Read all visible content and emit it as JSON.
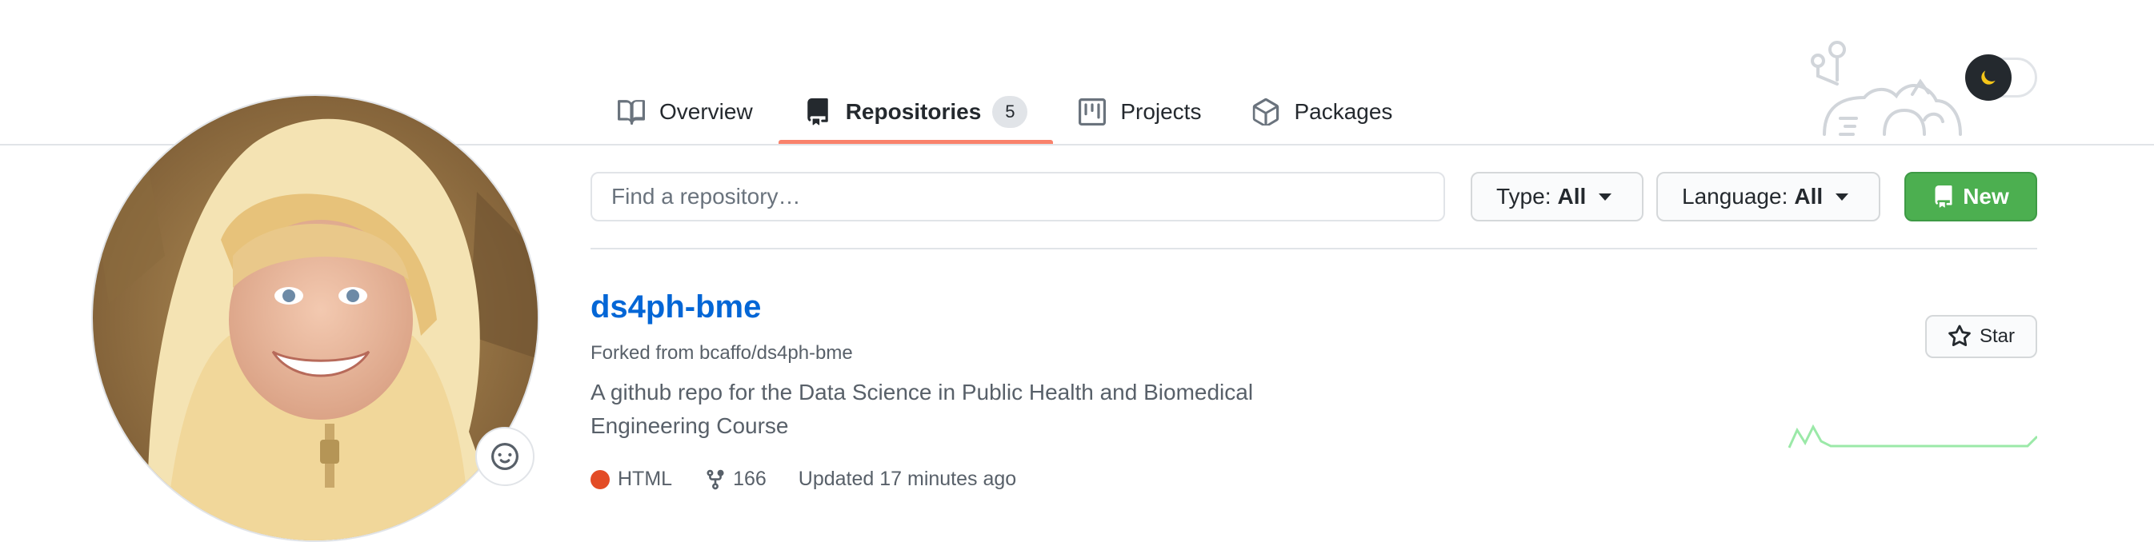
{
  "nav": {
    "tabs": [
      {
        "label": "Overview",
        "icon": "book-icon"
      },
      {
        "label": "Repositories",
        "icon": "repo-icon",
        "count": "5"
      },
      {
        "label": "Projects",
        "icon": "project-icon"
      },
      {
        "label": "Packages",
        "icon": "package-icon"
      }
    ]
  },
  "filter": {
    "search_placeholder": "Find a repository…",
    "type_label": "Type:",
    "type_value": "All",
    "language_label": "Language:",
    "language_value": "All",
    "new_label": "New"
  },
  "repo": {
    "name": "ds4ph-bme",
    "forked_from": "Forked from bcaffo/ds4ph-bme",
    "description": "A github repo for the Data Science in Public Health and Biomedical Engineering Course",
    "language": "HTML",
    "language_color": "#e34c26",
    "forks": "166",
    "updated": "Updated 17 minutes ago",
    "star_label": "Star"
  },
  "colors": {
    "accent_tab": "#f9826c",
    "link": "#0366d6",
    "new_button": "#4caf50",
    "sparkline": "#9be9a8"
  }
}
